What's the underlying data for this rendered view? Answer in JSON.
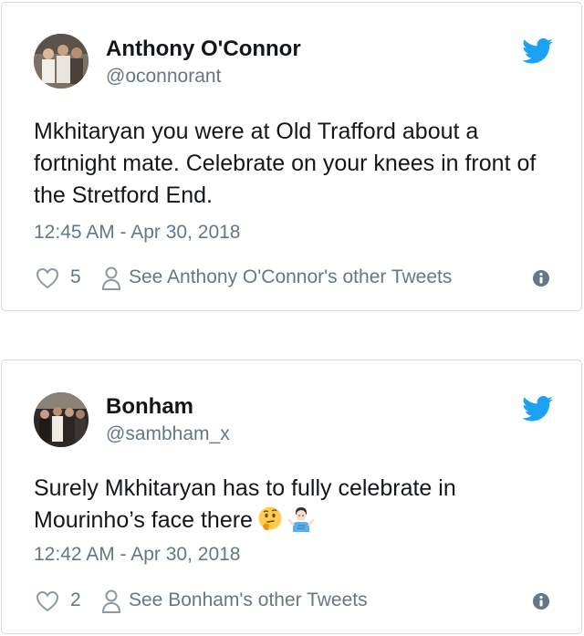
{
  "tweets": [
    {
      "name": "Anthony O'Connor",
      "handle": "@oconnorant",
      "text": "Mkhitaryan you were at Old Trafford about a fortnight mate. Celebrate on your knees in front of the Stretford End.",
      "timestamp": "12:45 AM - Apr 30, 2018",
      "likes": "5",
      "other_tweets_link": "See Anthony O'Connor's other Tweets",
      "icons": [
        "twitter-bird-icon",
        "heart-icon",
        "person-icon",
        "info-icon"
      ]
    },
    {
      "name": "Bonham",
      "handle": "@sambham_x",
      "text": "Surely Mkhitaryan has to fully celebrate in Mourinho’s face there",
      "emojis": [
        "thinking-face-emoji",
        "man-shrugging-emoji"
      ],
      "timestamp": "12:42 AM - Apr 30, 2018",
      "likes": "2",
      "other_tweets_link": "See Bonham's other Tweets",
      "icons": [
        "twitter-bird-icon",
        "heart-icon",
        "person-icon",
        "info-icon"
      ]
    }
  ],
  "colors": {
    "text": "#14171a",
    "secondary": "#657786",
    "twitter_blue": "#1da1f2",
    "border": "#d4d8dc"
  }
}
